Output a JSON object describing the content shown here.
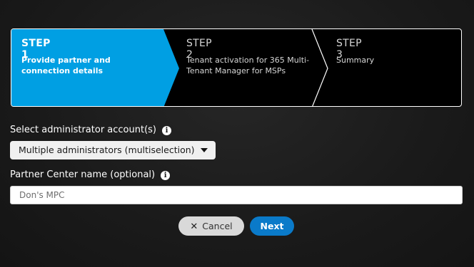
{
  "wizard": {
    "steps": [
      {
        "number": "STEP 1",
        "description": "Provide partner and connection details",
        "active": true
      },
      {
        "number": "STEP 2",
        "description": "Tenant activation for 365 Multi-Tenant Manager for MSPs",
        "active": false
      },
      {
        "number": "STEP 3",
        "description": "Summary",
        "active": false
      }
    ],
    "active_color": "#009fe3"
  },
  "form": {
    "admin_label": "Select administrator account(s)",
    "admin_select_value": "Multiple administrators (multiselection)",
    "partner_label": "Partner Center name (optional)",
    "partner_value": "Don's MPC",
    "info_glyph": "i"
  },
  "actions": {
    "cancel_label": "Cancel",
    "next_label": "Next",
    "next_color": "#0a7ac9"
  },
  "icons": {
    "info": "info-icon",
    "close": "close-icon",
    "caret": "caret-down-icon"
  }
}
